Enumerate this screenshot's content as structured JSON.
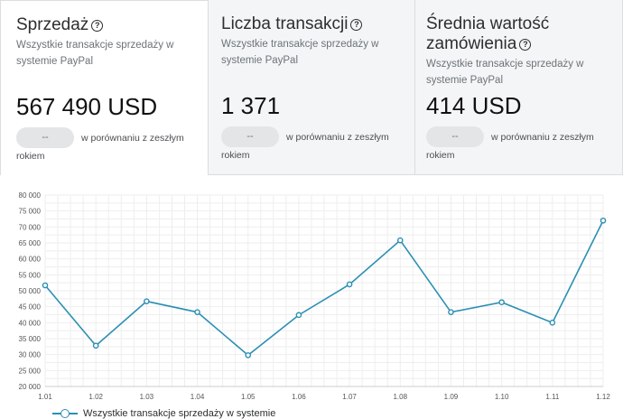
{
  "cards": [
    {
      "title": "Sprzedaż",
      "subtitle": "Wszystkie transakcje sprzedaży w systemie PayPal",
      "value": "567 490 USD",
      "pill": "--",
      "compare_line1": "w porównaniu z zeszłym",
      "compare_line2": "rokiem"
    },
    {
      "title": "Liczba transakcji",
      "subtitle": "Wszystkie transakcje sprzedaży w systemie PayPal",
      "value": "1 371",
      "pill": "--",
      "compare_line1": "w porównaniu z zeszłym",
      "compare_line2": "rokiem"
    },
    {
      "title": "Średnia wartość zamówienia",
      "subtitle": "Wszystkie transakcje sprzedaży w systemie PayPal",
      "value": "414 USD",
      "pill": "--",
      "compare_line1": "w porównaniu z zeszłym",
      "compare_line2": "rokiem"
    }
  ],
  "help_glyph": "?",
  "chart_data": {
    "type": "line",
    "categories": [
      "1.01",
      "1.02",
      "1.03",
      "1.04",
      "1.05",
      "1.06",
      "1.07",
      "1.08",
      "1.09",
      "1.10",
      "1.11",
      "1.12"
    ],
    "series": [
      {
        "name": "Wszystkie transakcje sprzedaży w systemie",
        "values": [
          51700,
          32800,
          46700,
          43300,
          29800,
          42400,
          52000,
          65800,
          43300,
          46400,
          40000,
          72000
        ]
      }
    ],
    "yticks": [
      "20 000",
      "25 000",
      "30 000",
      "35 000",
      "40 000",
      "45 000",
      "50 000",
      "55 000",
      "60 000",
      "65 000",
      "70 000",
      "75 000",
      "80 000"
    ],
    "ylim": [
      20000,
      80000
    ],
    "grid": true,
    "line_color": "#2b8fb3",
    "legend": "bottom-left"
  }
}
